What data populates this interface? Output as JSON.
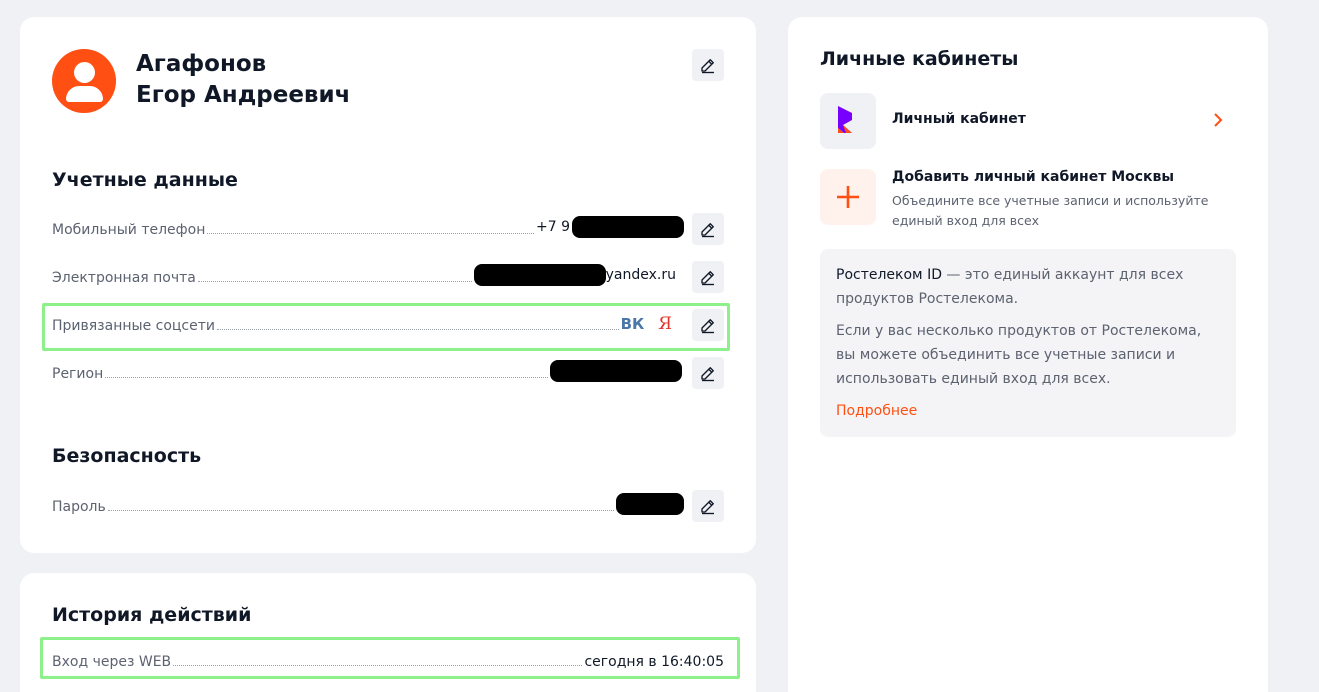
{
  "profile": {
    "last_name": "Агафонов",
    "first_names": "Егор Андреевич"
  },
  "account": {
    "title": "Учетные данные",
    "rows": [
      {
        "label": "Мобильный телефон",
        "value": "+7 9"
      },
      {
        "label": "Электронная почта",
        "value": "yandex.ru"
      },
      {
        "label": "Привязанные соцсети",
        "social": [
          "ВК",
          "Я"
        ]
      },
      {
        "label": "Регион",
        "value": ""
      }
    ]
  },
  "security": {
    "title": "Безопасность",
    "rows": [
      {
        "label": "Пароль",
        "value": ""
      }
    ]
  },
  "history": {
    "title": "История действий",
    "rows": [
      {
        "label": "Вход через WEB",
        "value": "сегодня в 16:40:05"
      }
    ]
  },
  "accounts": {
    "title": "Личные кабинеты",
    "items": [
      {
        "title": "Личный кабинет",
        "icon": "rostelecom-logo-icon"
      },
      {
        "title": "Добавить личный кабинет Москвы",
        "description": "Объедините все учетные записи и используйте единый вход для всех",
        "icon": "plus-icon"
      }
    ],
    "info": {
      "brand": "Ростелеком ID",
      "text1": " — это единый аккаунт для всех продуктов Ростелекома.",
      "text2": "Если у вас несколько продуктов от Ростелекома, вы можете объединить все учетные записи и использовать единый вход для всех.",
      "link": "Подробнее"
    }
  },
  "colors": {
    "accent": "#ff4f12",
    "highlight": "#8ef08a",
    "vk": "#4a76a8",
    "yandex": "#e0362a"
  }
}
